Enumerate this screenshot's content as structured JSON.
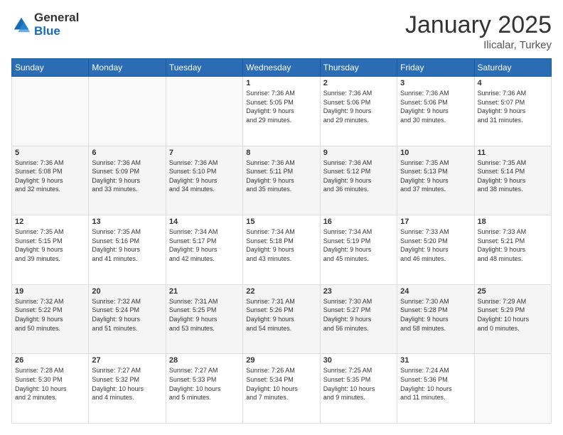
{
  "logo": {
    "general": "General",
    "blue": "Blue"
  },
  "header": {
    "month": "January 2025",
    "location": "Ilicalar, Turkey"
  },
  "weekdays": [
    "Sunday",
    "Monday",
    "Tuesday",
    "Wednesday",
    "Thursday",
    "Friday",
    "Saturday"
  ],
  "weeks": [
    [
      {
        "day": "",
        "info": ""
      },
      {
        "day": "",
        "info": ""
      },
      {
        "day": "",
        "info": ""
      },
      {
        "day": "1",
        "info": "Sunrise: 7:36 AM\nSunset: 5:05 PM\nDaylight: 9 hours\nand 29 minutes."
      },
      {
        "day": "2",
        "info": "Sunrise: 7:36 AM\nSunset: 5:06 PM\nDaylight: 9 hours\nand 29 minutes."
      },
      {
        "day": "3",
        "info": "Sunrise: 7:36 AM\nSunset: 5:06 PM\nDaylight: 9 hours\nand 30 minutes."
      },
      {
        "day": "4",
        "info": "Sunrise: 7:36 AM\nSunset: 5:07 PM\nDaylight: 9 hours\nand 31 minutes."
      }
    ],
    [
      {
        "day": "5",
        "info": "Sunrise: 7:36 AM\nSunset: 5:08 PM\nDaylight: 9 hours\nand 32 minutes."
      },
      {
        "day": "6",
        "info": "Sunrise: 7:36 AM\nSunset: 5:09 PM\nDaylight: 9 hours\nand 33 minutes."
      },
      {
        "day": "7",
        "info": "Sunrise: 7:36 AM\nSunset: 5:10 PM\nDaylight: 9 hours\nand 34 minutes."
      },
      {
        "day": "8",
        "info": "Sunrise: 7:36 AM\nSunset: 5:11 PM\nDaylight: 9 hours\nand 35 minutes."
      },
      {
        "day": "9",
        "info": "Sunrise: 7:36 AM\nSunset: 5:12 PM\nDaylight: 9 hours\nand 36 minutes."
      },
      {
        "day": "10",
        "info": "Sunrise: 7:35 AM\nSunset: 5:13 PM\nDaylight: 9 hours\nand 37 minutes."
      },
      {
        "day": "11",
        "info": "Sunrise: 7:35 AM\nSunset: 5:14 PM\nDaylight: 9 hours\nand 38 minutes."
      }
    ],
    [
      {
        "day": "12",
        "info": "Sunrise: 7:35 AM\nSunset: 5:15 PM\nDaylight: 9 hours\nand 39 minutes."
      },
      {
        "day": "13",
        "info": "Sunrise: 7:35 AM\nSunset: 5:16 PM\nDaylight: 9 hours\nand 41 minutes."
      },
      {
        "day": "14",
        "info": "Sunrise: 7:34 AM\nSunset: 5:17 PM\nDaylight: 9 hours\nand 42 minutes."
      },
      {
        "day": "15",
        "info": "Sunrise: 7:34 AM\nSunset: 5:18 PM\nDaylight: 9 hours\nand 43 minutes."
      },
      {
        "day": "16",
        "info": "Sunrise: 7:34 AM\nSunset: 5:19 PM\nDaylight: 9 hours\nand 45 minutes."
      },
      {
        "day": "17",
        "info": "Sunrise: 7:33 AM\nSunset: 5:20 PM\nDaylight: 9 hours\nand 46 minutes."
      },
      {
        "day": "18",
        "info": "Sunrise: 7:33 AM\nSunset: 5:21 PM\nDaylight: 9 hours\nand 48 minutes."
      }
    ],
    [
      {
        "day": "19",
        "info": "Sunrise: 7:32 AM\nSunset: 5:22 PM\nDaylight: 9 hours\nand 50 minutes."
      },
      {
        "day": "20",
        "info": "Sunrise: 7:32 AM\nSunset: 5:24 PM\nDaylight: 9 hours\nand 51 minutes."
      },
      {
        "day": "21",
        "info": "Sunrise: 7:31 AM\nSunset: 5:25 PM\nDaylight: 9 hours\nand 53 minutes."
      },
      {
        "day": "22",
        "info": "Sunrise: 7:31 AM\nSunset: 5:26 PM\nDaylight: 9 hours\nand 54 minutes."
      },
      {
        "day": "23",
        "info": "Sunrise: 7:30 AM\nSunset: 5:27 PM\nDaylight: 9 hours\nand 56 minutes."
      },
      {
        "day": "24",
        "info": "Sunrise: 7:30 AM\nSunset: 5:28 PM\nDaylight: 9 hours\nand 58 minutes."
      },
      {
        "day": "25",
        "info": "Sunrise: 7:29 AM\nSunset: 5:29 PM\nDaylight: 10 hours\nand 0 minutes."
      }
    ],
    [
      {
        "day": "26",
        "info": "Sunrise: 7:28 AM\nSunset: 5:30 PM\nDaylight: 10 hours\nand 2 minutes."
      },
      {
        "day": "27",
        "info": "Sunrise: 7:27 AM\nSunset: 5:32 PM\nDaylight: 10 hours\nand 4 minutes."
      },
      {
        "day": "28",
        "info": "Sunrise: 7:27 AM\nSunset: 5:33 PM\nDaylight: 10 hours\nand 5 minutes."
      },
      {
        "day": "29",
        "info": "Sunrise: 7:26 AM\nSunset: 5:34 PM\nDaylight: 10 hours\nand 7 minutes."
      },
      {
        "day": "30",
        "info": "Sunrise: 7:25 AM\nSunset: 5:35 PM\nDaylight: 10 hours\nand 9 minutes."
      },
      {
        "day": "31",
        "info": "Sunrise: 7:24 AM\nSunset: 5:36 PM\nDaylight: 10 hours\nand 11 minutes."
      },
      {
        "day": "",
        "info": ""
      }
    ]
  ]
}
